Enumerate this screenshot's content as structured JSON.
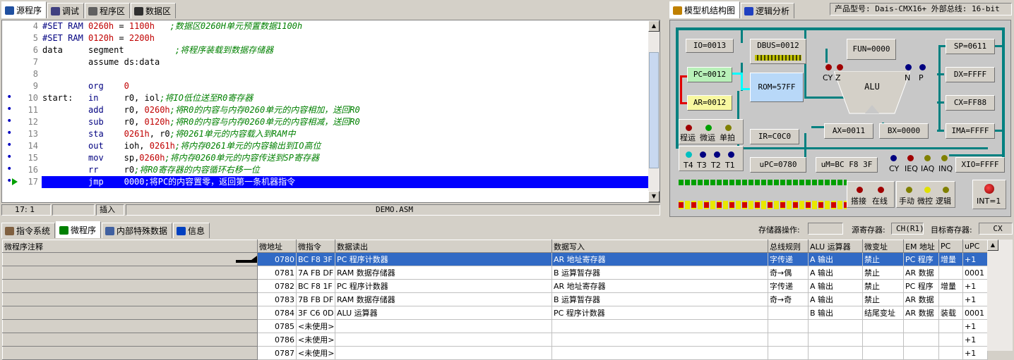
{
  "top_tabs": [
    {
      "label": "源程序",
      "icon": "source-icon"
    },
    {
      "label": "调试",
      "icon": "debug-icon"
    },
    {
      "label": "程序区",
      "icon": "program-area-icon"
    },
    {
      "label": "数据区",
      "icon": "data-area-icon"
    }
  ],
  "right_tabs": [
    {
      "label": "模型机结构图",
      "icon": "model-structure-icon"
    },
    {
      "label": "逻辑分析",
      "icon": "logic-analysis-icon"
    }
  ],
  "product_info": "产品型号: Dais-CMX16+  外部总线: 16-bit",
  "code_lines": [
    {
      "num": "4",
      "marker": "",
      "parts": [
        [
          "#SET RAM ",
          "kw"
        ],
        [
          "0260h",
          "nm"
        ],
        [
          " = ",
          ""
        ],
        [
          "1100h",
          "nm"
        ],
        [
          "   ;数据区0260H单元预置数据1100h",
          "cm"
        ]
      ]
    },
    {
      "num": "5",
      "marker": "",
      "parts": [
        [
          "#SET RAM ",
          "kw"
        ],
        [
          "0120h",
          "nm"
        ],
        [
          " = ",
          ""
        ],
        [
          "2200h",
          "nm"
        ]
      ]
    },
    {
      "num": "6",
      "marker": "",
      "parts": [
        [
          "data     segment          ",
          ""
        ],
        [
          ";将程序装载到数据存储器",
          "cm"
        ]
      ]
    },
    {
      "num": "7",
      "marker": "",
      "parts": [
        [
          "         assume ds:data",
          ""
        ]
      ]
    },
    {
      "num": "8",
      "marker": "",
      "parts": []
    },
    {
      "num": "9",
      "marker": "",
      "parts": [
        [
          "         ",
          ""
        ],
        [
          "org",
          "kw"
        ],
        [
          "    ",
          ""
        ],
        [
          "0",
          "nm"
        ]
      ]
    },
    {
      "num": "10",
      "marker": "dot",
      "parts": [
        [
          "start:   ",
          ""
        ],
        [
          "in",
          "kw"
        ],
        [
          "     r0, iol",
          ""
        ],
        [
          ";将IO低位送至R0寄存器",
          "cm"
        ]
      ]
    },
    {
      "num": "11",
      "marker": "dot",
      "parts": [
        [
          "         ",
          ""
        ],
        [
          "add",
          "kw"
        ],
        [
          "    r0, ",
          ""
        ],
        [
          "0260h",
          "nm"
        ],
        [
          ";将R0的内容与内存0260单元的内容相加，送回R0",
          "cm"
        ]
      ]
    },
    {
      "num": "12",
      "marker": "dot",
      "parts": [
        [
          "         ",
          ""
        ],
        [
          "sub",
          "kw"
        ],
        [
          "    r0, ",
          ""
        ],
        [
          "0120h",
          "nm"
        ],
        [
          ";将R0的内容与内存0260单元的内容相减，送回R0",
          "cm"
        ]
      ]
    },
    {
      "num": "13",
      "marker": "dot",
      "parts": [
        [
          "         ",
          ""
        ],
        [
          "sta",
          "kw"
        ],
        [
          "    ",
          ""
        ],
        [
          "0261h",
          "nm"
        ],
        [
          ", r0",
          ""
        ],
        [
          ";将0261单元的内容载入到RAM中",
          "cm"
        ]
      ]
    },
    {
      "num": "14",
      "marker": "dot",
      "parts": [
        [
          "         ",
          ""
        ],
        [
          "out",
          "kw"
        ],
        [
          "    ioh, ",
          ""
        ],
        [
          "0261h",
          "nm"
        ],
        [
          ";将内存0261单元的内容输出到IO高位",
          "cm"
        ]
      ]
    },
    {
      "num": "15",
      "marker": "dot",
      "parts": [
        [
          "         ",
          ""
        ],
        [
          "mov",
          "kw"
        ],
        [
          "    sp,",
          ""
        ],
        [
          "0260h",
          "nm"
        ],
        [
          ";将内存0260单元的内容传送到SP寄存器",
          "cm"
        ]
      ]
    },
    {
      "num": "16",
      "marker": "dot",
      "parts": [
        [
          "         ",
          ""
        ],
        [
          "rr",
          "kw"
        ],
        [
          "     r0",
          ""
        ],
        [
          ";将R0寄存器的内容循环右移一位",
          "cm"
        ]
      ]
    },
    {
      "num": "17",
      "marker": "arrow",
      "parts": [
        [
          "         jmp    0000",
          ""
        ],
        [
          ";将PC的内容置零，返回第一条机器指令",
          ""
        ]
      ]
    }
  ],
  "status": {
    "pos": "17:   1",
    "mode": "插入",
    "file": "DEMO.ASM"
  },
  "regs": {
    "io": "IO=0013",
    "dbus": "DBUS=0012",
    "fun": "FUN=0000",
    "sp": "SP=0611",
    "pc": "PC=0012",
    "rom": "ROM=57FF",
    "ar": "AR=0012",
    "alu": "ALU",
    "dx": "DX=FFFF",
    "cx": "CX=FF88",
    "ir": "IR=C0C0",
    "ax": "AX=0011",
    "bx": "BX=0000",
    "ima": "IMA=FFFF",
    "upc": "uPC=0780",
    "um": "uM=BC F8 3F",
    "xio": "XIO=FFFF",
    "int": "INT=1"
  },
  "flags_top": [
    {
      "label": "CY",
      "color": "#a00000"
    },
    {
      "label": "Z",
      "color": "#a00000"
    },
    {
      "label": "N",
      "color": "#000080"
    },
    {
      "label": "P",
      "color": "#000080"
    }
  ],
  "run_leds": [
    {
      "label": "程运",
      "color": "#a00000"
    },
    {
      "label": "微运",
      "color": "#00a000"
    },
    {
      "label": "单拍",
      "color": "#808000"
    }
  ],
  "t_leds": [
    {
      "label": "T4",
      "color": "#00c0c0"
    },
    {
      "label": "T3",
      "color": "#000080"
    },
    {
      "label": "T2",
      "color": "#000080"
    },
    {
      "label": "T1",
      "color": "#000080"
    }
  ],
  "int_flags": [
    {
      "label": "CY",
      "color": "#000080"
    },
    {
      "label": "IEQ",
      "color": "#a00000"
    },
    {
      "label": "IAQ",
      "color": "#808000"
    },
    {
      "label": "INQ",
      "color": "#808000"
    }
  ],
  "conn_leds": [
    {
      "label": "搭接",
      "color": "#a00000"
    },
    {
      "label": "在线",
      "color": "#a00000"
    }
  ],
  "mode_leds": [
    {
      "label": "手动",
      "color": "#808000"
    },
    {
      "label": "微控",
      "color": "#e0e000"
    },
    {
      "label": "逻辑",
      "color": "#808000"
    }
  ],
  "bottom_tabs": [
    {
      "label": "指令系统",
      "icon": "instruction-icon"
    },
    {
      "label": "微程序",
      "icon": "microprogram-icon"
    },
    {
      "label": "内部特殊数据",
      "icon": "search-icon"
    },
    {
      "label": "信息",
      "icon": "info-icon"
    }
  ],
  "mem_op_label": "存储器操作:",
  "mem_op_value": "",
  "src_reg_label": "源寄存器:",
  "src_reg_value": "CH(R1)",
  "dst_reg_label": "目标寄存器:",
  "dst_reg_value": "CX",
  "table": {
    "headers": [
      "微程序注释",
      "微地址",
      "微指令",
      "数据读出",
      "数据写入",
      "总线规则",
      "ALU 运算器",
      "微变址",
      "EM 地址",
      "PC",
      "uPC"
    ],
    "rows": [
      [
        "",
        "0780",
        "BC F8 3F",
        "PC 程序计数器",
        "AR 地址寄存器",
        "字传递",
        "A 输出",
        "禁止",
        "PC 程序",
        "增量",
        "+1"
      ],
      [
        "",
        "0781",
        "7A FB DF",
        "RAM 数据存储器",
        "B 运算暂存器",
        "奇→偶",
        "A 输出",
        "禁止",
        "AR 数据",
        "",
        "0001"
      ],
      [
        "",
        "0782",
        "BC F8 1F",
        "PC 程序计数器",
        "AR 地址寄存器",
        "字传递",
        "A 输出",
        "禁止",
        "PC 程序",
        "增量",
        "+1"
      ],
      [
        "",
        "0783",
        "7B FB DF",
        "RAM 数据存储器",
        "B 运算暂存器",
        "奇→奇",
        "A 输出",
        "禁止",
        "AR 数据",
        "",
        "+1"
      ],
      [
        "",
        "0784",
        "3F C6 0D",
        "ALU 运算器",
        "PC 程序计数器",
        "",
        "B 输出",
        "结尾变址",
        "AR 数据",
        "装载",
        "0001"
      ],
      [
        "",
        "0785",
        "<未使用>",
        "",
        "",
        "",
        "",
        "",
        "",
        "",
        "+1"
      ],
      [
        "",
        "0786",
        "<未使用>",
        "",
        "",
        "",
        "",
        "",
        "",
        "",
        "+1"
      ],
      [
        "",
        "0787",
        "<未使用>",
        "",
        "",
        "",
        "",
        "",
        "",
        "",
        "+1"
      ]
    ]
  }
}
